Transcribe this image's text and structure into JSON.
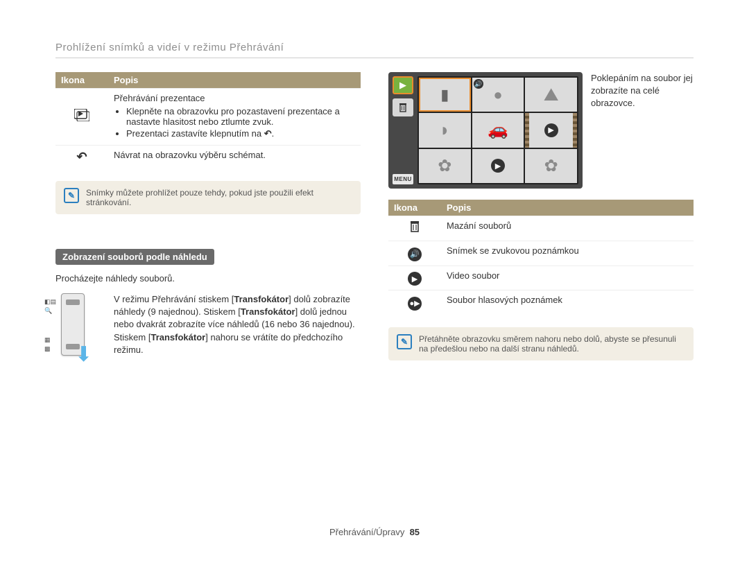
{
  "breadcrumb": "Prohlížení snímků a videí v režimu Přehrávání",
  "table_headers": {
    "icon": "Ikona",
    "desc": "Popis"
  },
  "left_table": [
    {
      "title": "Přehrávání prezentace",
      "bullets": [
        "Klepněte na obrazovku pro pozastavení prezentace a nastavte hlasitost nebo ztlumte zvuk.",
        "Prezentaci zastavíte klepnutím na"
      ]
    },
    {
      "title": "Návrat na obrazovku výběru schémat."
    }
  ],
  "left_note": "Snímky můžete prohlížet pouze tehdy, pokud jste použili efekt stránkování.",
  "sub_heading": "Zobrazení souborů podle náhledu",
  "sub_text": "Procházejte náhledy souborů.",
  "zoom_text_parts": {
    "a": "V režimu Přehrávání stiskem [",
    "b": "Transfokátor",
    "c": "] dolů zobrazíte náhledy (9 najednou). Stiskem [",
    "d": "Transfokátor",
    "e": "] dolů jednou nebo dvakrát zobrazíte více náhledů (16 nebo 36 najednou).",
    "f": "Stiskem [",
    "g": "Transfokátor",
    "h": "] nahoru se vrátíte do předchozího režimu."
  },
  "screen_caption": "Poklepáním na soubor jej zobrazíte na celé obrazovce.",
  "menu_label": "MENU",
  "right_table": [
    {
      "desc": "Mazání souborů"
    },
    {
      "desc": "Snímek se zvukovou poznámkou"
    },
    {
      "desc": "Video soubor"
    },
    {
      "desc": "Soubor hlasových poznámek"
    }
  ],
  "right_note": "Přetáhněte obrazovku směrem nahoru nebo dolů, abyste se přesunuli na předešlou nebo na další stranu náhledů.",
  "footer": {
    "section": "Přehrávání/Úpravy",
    "page": "85"
  }
}
